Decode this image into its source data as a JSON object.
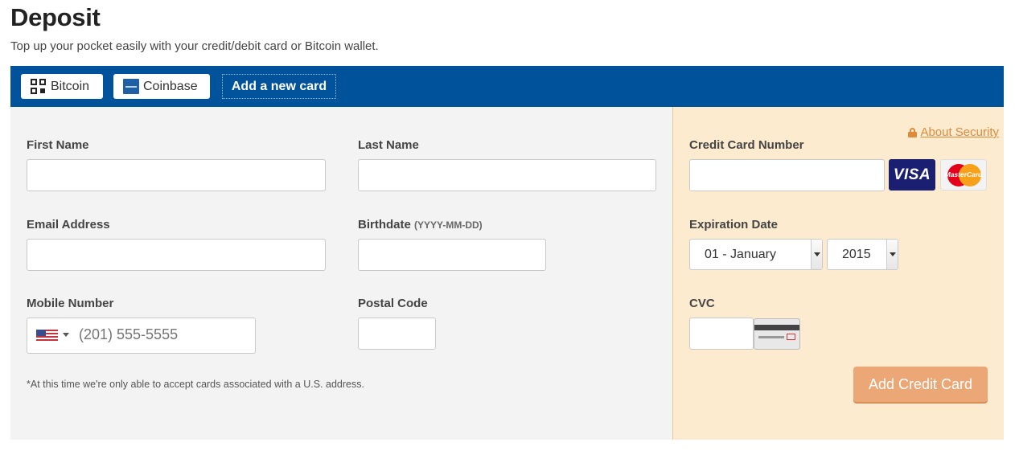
{
  "page": {
    "title": "Deposit",
    "subtitle": "Top up your pocket easily with your credit/debit card or Bitcoin wallet."
  },
  "tabs": [
    {
      "label": "Bitcoin",
      "icon": "qr-code-icon"
    },
    {
      "label": "Coinbase",
      "icon": "coinbase-icon"
    },
    {
      "label": "Add a new card",
      "active": true
    }
  ],
  "form": {
    "first_name": {
      "label": "First Name",
      "value": ""
    },
    "last_name": {
      "label": "Last Name",
      "value": ""
    },
    "email": {
      "label": "Email Address",
      "value": ""
    },
    "birthdate": {
      "label": "Birthdate",
      "hint": "(YYYY-MM-DD)",
      "value": ""
    },
    "mobile": {
      "label": "Mobile Number",
      "placeholder": "(201) 555-5555",
      "country_flag": "us-flag-icon"
    },
    "postal_code": {
      "label": "Postal Code",
      "value": ""
    },
    "note": "*At this time we're only able to accept cards associated with a U.S. address."
  },
  "card": {
    "security_link": "About Security",
    "number": {
      "label": "Credit Card Number",
      "value": ""
    },
    "brands": [
      "VISA",
      "MasterCard"
    ],
    "expiration": {
      "label": "Expiration Date",
      "month": "01 - January",
      "year": "2015"
    },
    "cvc": {
      "label": "CVC",
      "value": ""
    },
    "submit_label": "Add Credit Card"
  },
  "colors": {
    "header_blue": "#00539b",
    "accent_orange": "#e08a3c",
    "button_orange": "#eba876",
    "card_panel_bg": "#fdebcf"
  }
}
